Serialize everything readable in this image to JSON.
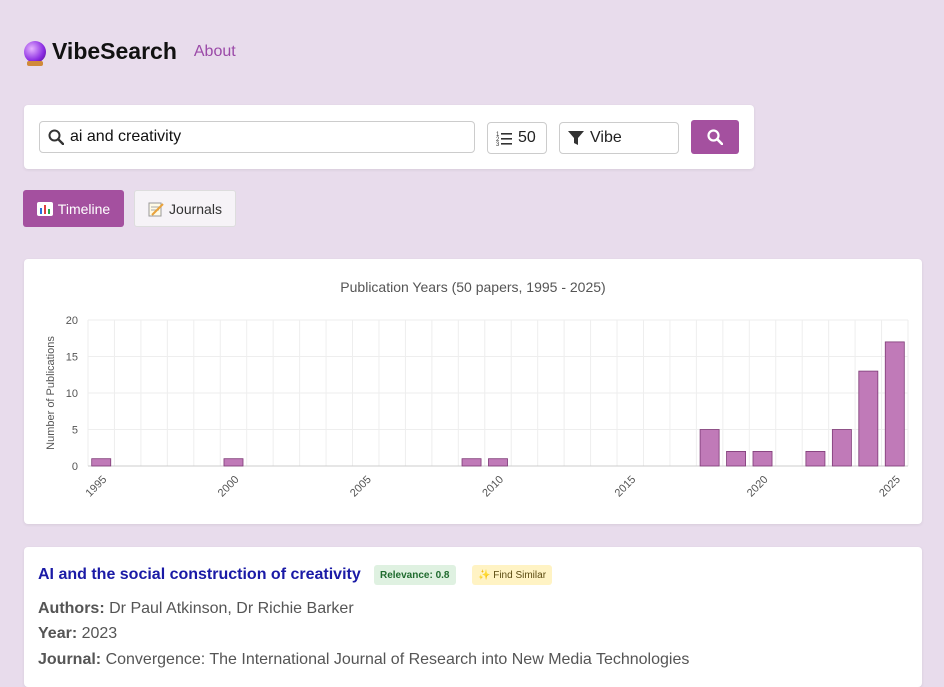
{
  "app": {
    "title": "VibeSearch",
    "about_link": "About",
    "logo_icon": "crystal-ball-icon"
  },
  "search": {
    "query": "ai and creativity",
    "count": "50",
    "mode": "Vibe",
    "accent_color": "#a4509f"
  },
  "tabs": [
    {
      "label": "Timeline",
      "icon": "chart-icon",
      "active": true
    },
    {
      "label": "Journals",
      "icon": "memo-icon",
      "active": false
    }
  ],
  "chart_data": {
    "type": "bar",
    "title": "Publication Years (50 papers, 1995 - 2025)",
    "ylabel": "Number of Publications",
    "xlabel": "",
    "x": [
      1995,
      2000,
      2009,
      2010,
      2018,
      2019,
      2020,
      2022,
      2023,
      2024,
      2025
    ],
    "values": [
      1,
      1,
      1,
      1,
      5,
      2,
      2,
      2,
      5,
      13,
      17
    ],
    "xlim": [
      1995,
      2025
    ],
    "ylim": [
      0,
      20
    ],
    "xticks": [
      "1995",
      "2000",
      "2005",
      "2010",
      "2015",
      "2020",
      "2025"
    ],
    "yticks": [
      "0",
      "5",
      "10",
      "15",
      "20"
    ],
    "bar_color": "#c07ab8",
    "grid": true
  },
  "result": {
    "title": "AI and the social construction of creativity",
    "relevance": "Relevance: 0.8",
    "find_similar": "✨ Find Similar",
    "authors_label": "Authors:",
    "authors": "Dr Paul Atkinson, Dr Richie Barker",
    "year_label": "Year:",
    "year": "2023",
    "journal_label": "Journal:",
    "journal": "Convergence: The International Journal of Research into New Media Technologies"
  }
}
